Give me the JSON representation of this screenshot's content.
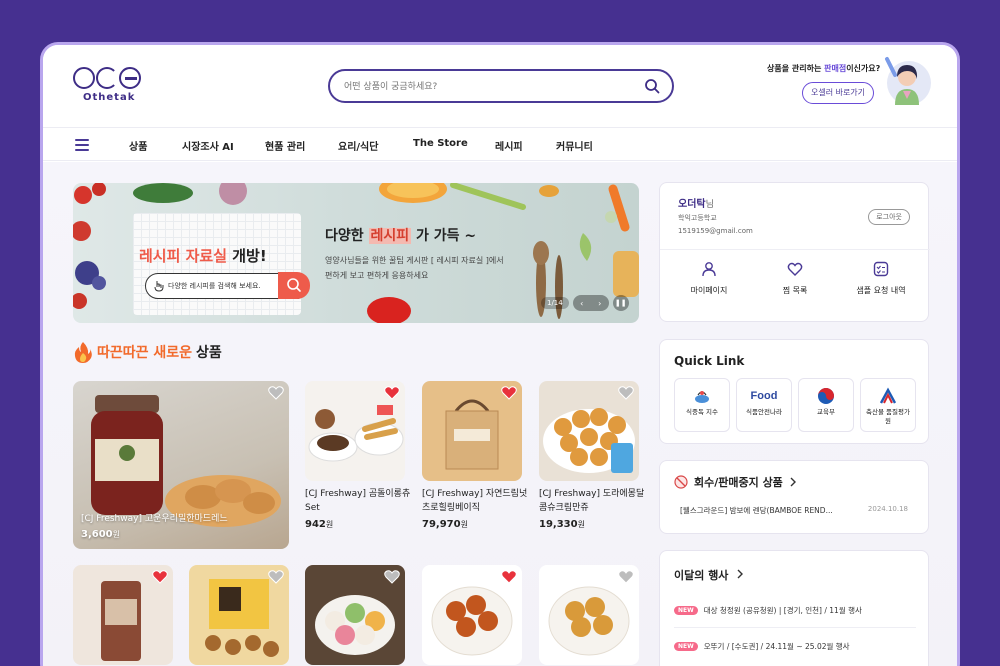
{
  "brand": {
    "name": "Othetak"
  },
  "search": {
    "placeholder": "어떤 상품이 궁금하세요?"
  },
  "seller": {
    "question_prefix": "상품을 관리하는 ",
    "question_highlight": "판매점",
    "question_suffix": "이신가요?",
    "button": "오셀러 바로가기"
  },
  "nav": {
    "items": [
      "상품",
      "시장조사 AI",
      "현품 관리",
      "요리/식단",
      "The Store",
      "레시피",
      "커뮤니티"
    ]
  },
  "banner": {
    "card_title_red": "레시피 자료실",
    "card_title_rest": " 개방!",
    "search_text": "다양한 레시피를 검색해 보세요.",
    "headline_pre": "다양한 ",
    "headline_hl": "레시피",
    "headline_post": " 가 가득 ~",
    "desc_line1": "영양사님들을 위한 꿀팁 게시판 [ 레시피 자료실 ]에서",
    "desc_line2": "편하게 보고 편하게 응용하세요",
    "counter": "1/14",
    "prev": "‹",
    "next": "›",
    "pause": "❚❚"
  },
  "section": {
    "title_hl": "따끈따끈 새로운",
    "title_rest": " 상품"
  },
  "products": {
    "featured": {
      "name": "[CJ Freshway] 고운우리밀한마드레느",
      "price": "3,600",
      "unit": "원"
    },
    "items": [
      {
        "name": "[CJ Freshway] 곰돌이롱츄Set",
        "price": "942",
        "unit": "원"
      },
      {
        "name": "[CJ Freshway] 자연드림넛츠로힐링베이직",
        "price": "79,970",
        "unit": "원"
      },
      {
        "name": "[CJ Freshway] 도라에몽달콤슈크림만쥬",
        "price": "19,330",
        "unit": "원"
      }
    ]
  },
  "user": {
    "name": "오더탁",
    "honorific": "님",
    "school": "학익고등학교",
    "email": "1519159@gmail.com",
    "logout": "로그아웃"
  },
  "user_menu": [
    "마이페이지",
    "찜 목록",
    "샘플 요청 내역"
  ],
  "quick_link": {
    "title": "Quick Link",
    "items": [
      {
        "label": "식중독 지수"
      },
      {
        "label": "식품안전나라",
        "logo_text": "Food"
      },
      {
        "label": "교육부"
      },
      {
        "label": "축산물 품질평가원"
      }
    ]
  },
  "recall": {
    "title": "회수/판매중지 상품",
    "item": "[웰스그라운드] 밤보에 렌당(BAMBOE REND...",
    "date": "2024.10.18"
  },
  "events": {
    "title": "이달의 행사",
    "badge": "NEW",
    "rows": [
      "대상 청정원 (공유청원) | [경기, 인천] / 11월 행사",
      "오뚜기 / [수도권] / 24.11월 ~ 25.02월 행사"
    ]
  },
  "colors": {
    "brand": "#3e2d86",
    "accent": "#6a4cd8",
    "heart_active": "#e8323c",
    "banner_red": "#ee5b4b"
  }
}
